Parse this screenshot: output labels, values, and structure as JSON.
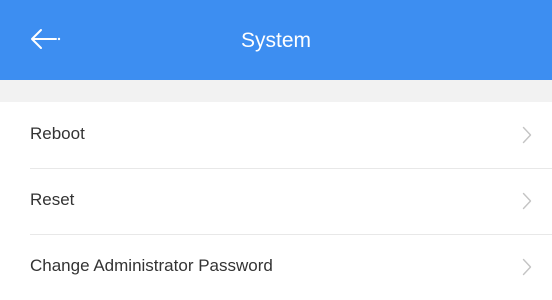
{
  "app_bar": {
    "title": "System",
    "back_icon": "arrow-left-icon",
    "background_color": "#3d8ef1"
  },
  "menu": {
    "items": [
      {
        "label": "Reboot",
        "icon": "chevron-right-icon"
      },
      {
        "label": "Reset",
        "icon": "chevron-right-icon"
      },
      {
        "label": "Change Administrator Password",
        "icon": "chevron-right-icon"
      }
    ]
  }
}
